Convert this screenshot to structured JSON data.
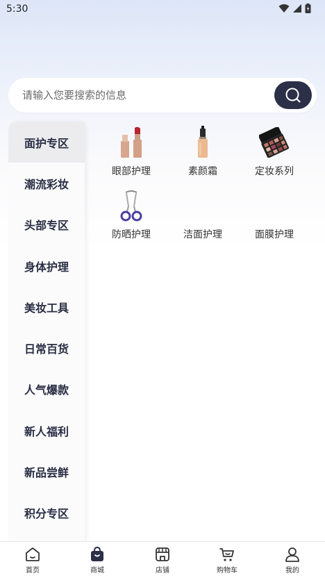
{
  "status_bar": {
    "time": "5:30"
  },
  "search": {
    "placeholder": "请输入您要搜索的信息"
  },
  "sidebar": {
    "items": [
      {
        "label": "面护专区",
        "active": true
      },
      {
        "label": "潮流彩妆"
      },
      {
        "label": "头部专区"
      },
      {
        "label": "身体护理"
      },
      {
        "label": "美妆工具"
      },
      {
        "label": "日常百货"
      },
      {
        "label": "人气爆款"
      },
      {
        "label": "新人福利"
      },
      {
        "label": "新品尝鲜"
      },
      {
        "label": "积分专区"
      }
    ]
  },
  "products": [
    {
      "label": "眼部护理",
      "icon": "lipstick-image"
    },
    {
      "label": "素颜霜",
      "icon": "foundation-bottle-image"
    },
    {
      "label": "定妆系列",
      "icon": "eyeshadow-palette-image"
    },
    {
      "label": "防晒护理",
      "icon": "eyelash-curler-image"
    },
    {
      "label": "洁面护理",
      "icon": ""
    },
    {
      "label": "面膜护理",
      "icon": ""
    }
  ],
  "bottom_nav": {
    "items": [
      {
        "label": "首页",
        "icon": "home-icon"
      },
      {
        "label": "商城",
        "icon": "shopping-bag-icon",
        "active": true
      },
      {
        "label": "店铺",
        "icon": "store-icon"
      },
      {
        "label": "购物车",
        "icon": "cart-icon"
      },
      {
        "label": "我的",
        "icon": "user-icon"
      }
    ]
  },
  "colors": {
    "accent": "#2b3048",
    "text": "#2a2e44"
  }
}
